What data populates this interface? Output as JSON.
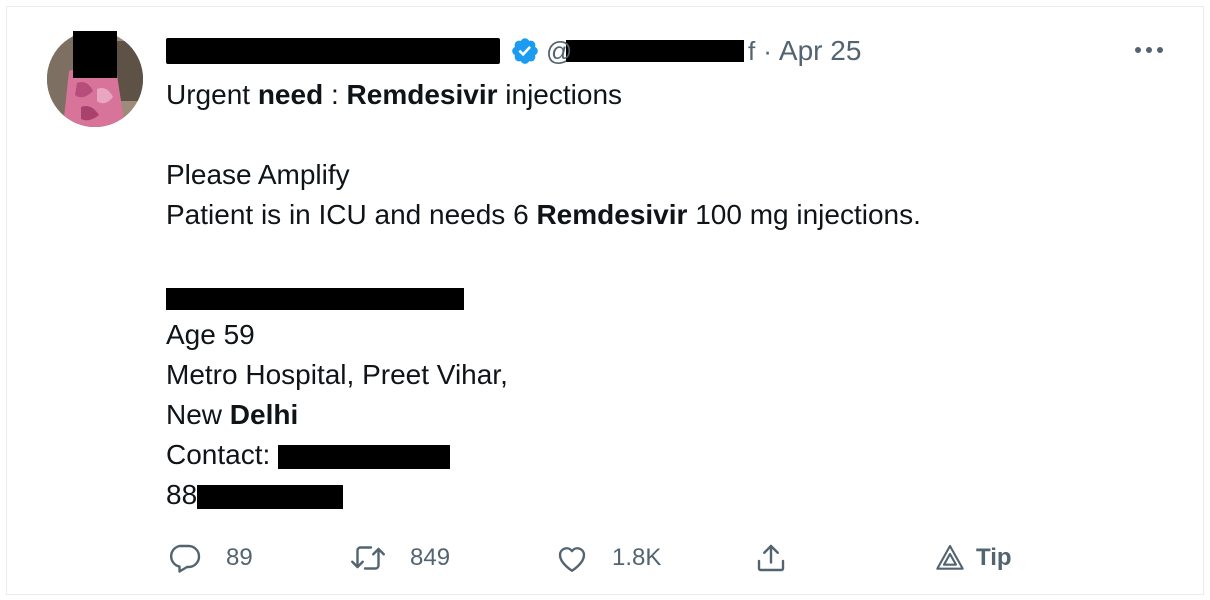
{
  "tweet": {
    "handle_prefix": "@",
    "handle_suffix": "f",
    "separator": "·",
    "date": "Apr 25",
    "line1": {
      "a": "Urgent ",
      "b": "need",
      "c": " : ",
      "d": "Remdesivir",
      "e": " injections"
    },
    "line2": "Please Amplify",
    "line3": {
      "a": "Patient is in ICU and needs 6 ",
      "b": "Remdesivir",
      "c": " 100 mg injections."
    },
    "age": "Age 59",
    "hospital": "Metro Hospital, Preet Vihar,",
    "city": {
      "a": "New ",
      "b": "Delhi"
    },
    "contact_label": "Contact: ",
    "phone_prefix": "88"
  },
  "actions": {
    "replies": "89",
    "retweets": "849",
    "likes": "1.8K",
    "tip_label": "Tip"
  },
  "colors": {
    "verified": "#1d9bf0",
    "muted": "#536471",
    "text": "#0f1419",
    "border": "#e6ecf0"
  },
  "icons": [
    "verified-badge-icon",
    "more-icon",
    "reply-icon",
    "retweet-icon",
    "like-icon",
    "share-icon",
    "tip-icon"
  ]
}
